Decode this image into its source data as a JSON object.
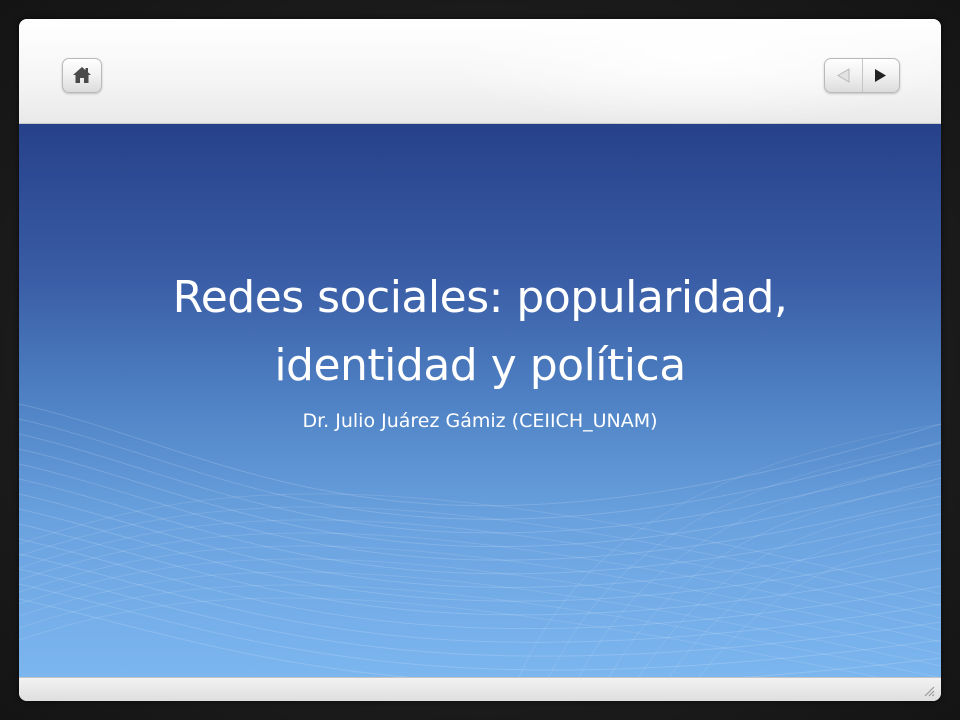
{
  "window": {
    "home_button": "home-icon",
    "prev_button": "triangle-left-icon",
    "next_button": "triangle-right-icon",
    "resize_grip": "resize-grip-icon"
  },
  "slide": {
    "title_line1": "Redes sociales: popularidad,",
    "title_line2": "identidad y política",
    "subtitle": "Dr. Julio Juárez Gámiz (CEIICH_UNAM)"
  },
  "colors": {
    "background_top": "#26418a",
    "background_bottom": "#7cb6ef",
    "text": "#ffffff",
    "chrome": "#f4f4f4"
  }
}
